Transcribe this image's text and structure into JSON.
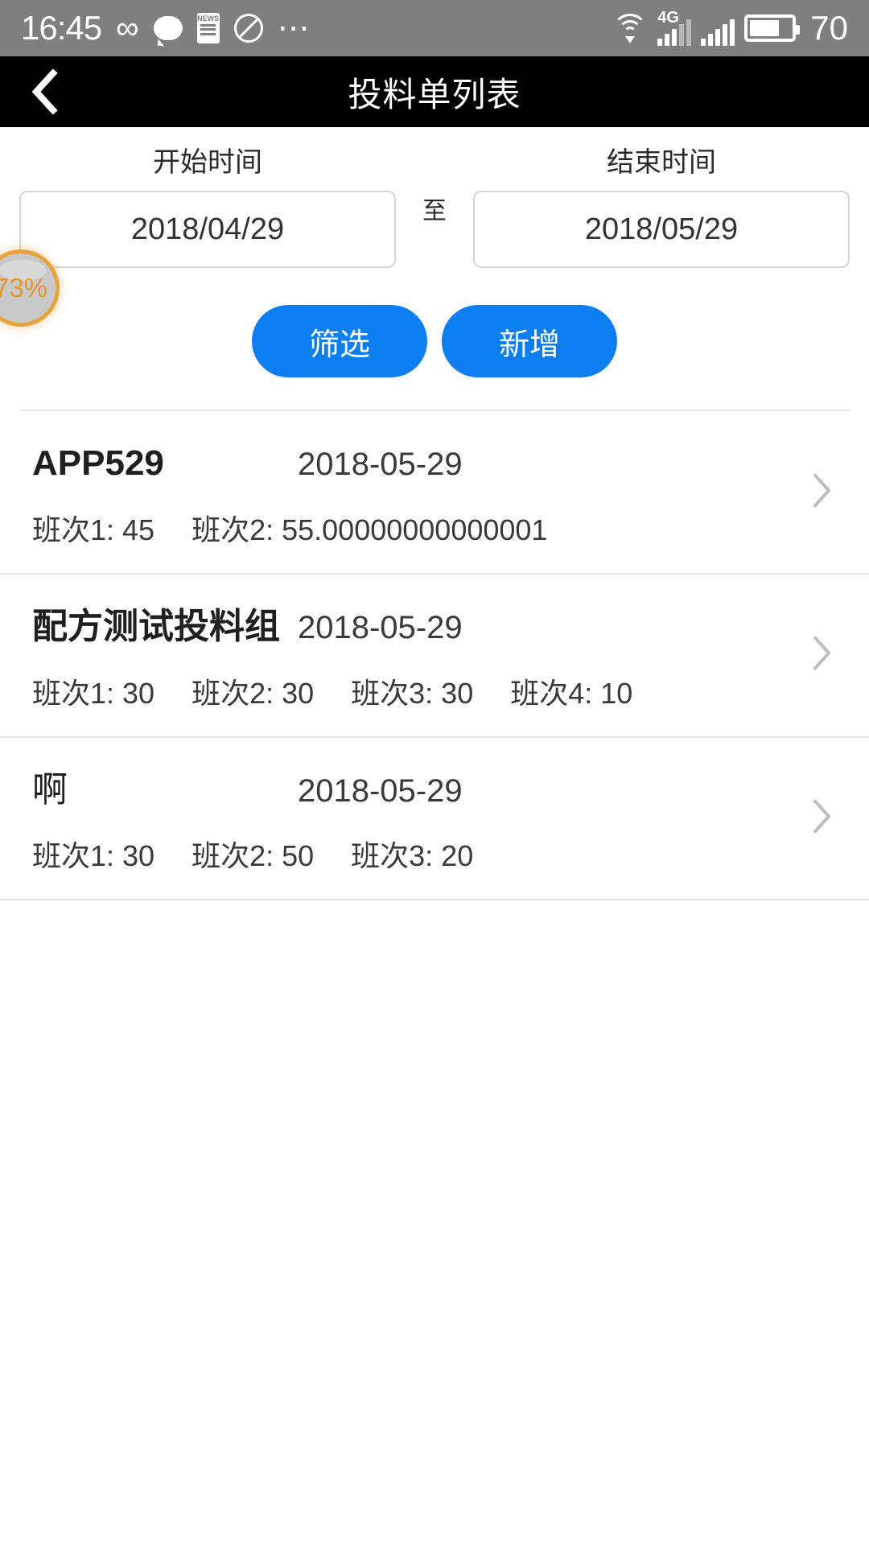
{
  "status_bar": {
    "time": "16:45",
    "battery_percent": "70",
    "network_type": "4G",
    "icons": [
      "infinity-icon",
      "chat-icon",
      "news-icon",
      "do-not-disturb-icon",
      "more-dots-icon",
      "wifi-icon",
      "signal-icon",
      "signal-icon-2",
      "battery-icon"
    ]
  },
  "nav": {
    "back_icon": "chevron-left-icon",
    "title": "投料单列表"
  },
  "filter": {
    "start_label": "开始时间",
    "start_value": "2018/04/29",
    "separator": "至",
    "end_label": "结束时间",
    "end_value": "2018/05/29",
    "filter_button": "筛选",
    "add_button": "新增",
    "accent_color": "#0c7ef2"
  },
  "progress_bubble": {
    "value": "73%",
    "ring_color": "#e8a33d",
    "text_color": "#e8962a"
  },
  "list": {
    "items": [
      {
        "title": "APP529",
        "date": "2018-05-29",
        "title_bold": true,
        "shifts": [
          "班次1: 45",
          "班次2: 55.00000000000001"
        ],
        "arrow_icon": "chevron-right-icon"
      },
      {
        "title": "配方测试投料组",
        "date": "2018-05-29",
        "title_bold": true,
        "shifts": [
          "班次1: 30",
          "班次2: 30",
          "班次3: 30",
          "班次4: 10"
        ],
        "arrow_icon": "chevron-right-icon"
      },
      {
        "title": "啊",
        "date": "2018-05-29",
        "title_bold": false,
        "shifts": [
          "班次1: 30",
          "班次2: 50",
          "班次3: 20"
        ],
        "arrow_icon": "chevron-right-icon"
      }
    ]
  }
}
